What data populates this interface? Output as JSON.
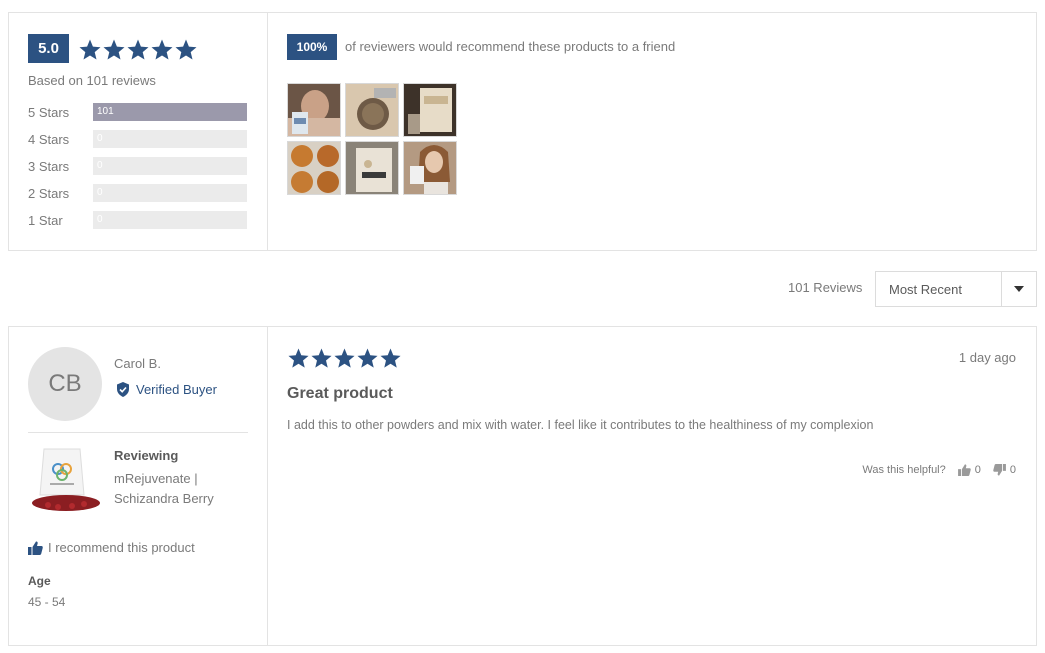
{
  "colors": {
    "accent": "#2c5282",
    "bar_fill": "#9b99ab",
    "bar_track": "#ebebeb"
  },
  "summary": {
    "average": "5.0",
    "average_stars": 5,
    "based_on": "Based on 101 reviews",
    "histogram": [
      {
        "label": "5 Stars",
        "count": "101",
        "fraction": 1.0
      },
      {
        "label": "4 Stars",
        "count": "0",
        "fraction": 0
      },
      {
        "label": "3 Stars",
        "count": "0",
        "fraction": 0
      },
      {
        "label": "2 Stars",
        "count": "0",
        "fraction": 0
      },
      {
        "label": "1 Star",
        "count": "0",
        "fraction": 0
      }
    ],
    "recommend_pct": "100%",
    "recommend_text": "of reviewers would recommend these products to a friend"
  },
  "sort": {
    "count_label": "101 Reviews",
    "selected": "Most Recent",
    "icon": "chevron-down-icon"
  },
  "review": {
    "initials": "CB",
    "author": "Carol B.",
    "verified": "Verified Buyer",
    "reviewing_label": "Reviewing",
    "product": "mRejuvenate | Schizandra Berry",
    "recommend": "I recommend this product",
    "age_label": "Age",
    "age_value": "45 - 54",
    "stars": 5,
    "date": "1 day ago",
    "title": "Great product",
    "body": "I add this to other powders and mix with water. I feel like it contributes to the healthiness of my complexion",
    "helpful_label": "Was this helpful?",
    "upvotes": "0",
    "downvotes": "0"
  }
}
